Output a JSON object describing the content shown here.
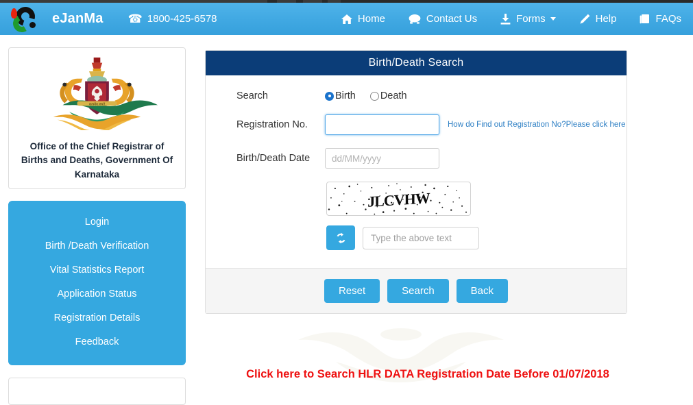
{
  "navbar": {
    "brand": "eJanMa",
    "phone": "1800-425-6578",
    "phone_icon": "phone-icon",
    "links": [
      {
        "label": "Home",
        "icon": "home-icon",
        "has_caret": false
      },
      {
        "label": "Contact Us",
        "icon": "telephone-icon",
        "has_caret": false
      },
      {
        "label": "Forms",
        "icon": "download-icon",
        "has_caret": true
      },
      {
        "label": "Help",
        "icon": "pencil-icon",
        "has_caret": false
      },
      {
        "label": "FAQs",
        "icon": "book-icon",
        "has_caret": false
      }
    ]
  },
  "sidebar": {
    "emblem_icon": "karnataka-state-emblem",
    "emblem_caption": "Office of the Chief Registrar of Births and Deaths, Government Of Karnataka",
    "menu": [
      {
        "label": "Login"
      },
      {
        "label": "Birth /Death Verification"
      },
      {
        "label": "Vital Statistics Report"
      },
      {
        "label": "Application Status"
      },
      {
        "label": "Registration Details"
      },
      {
        "label": "Feedback"
      }
    ]
  },
  "panel": {
    "title": "Birth/Death Search",
    "search_label": "Search",
    "search_options": [
      {
        "label": "Birth",
        "selected": true
      },
      {
        "label": "Death",
        "selected": false
      }
    ],
    "registration_label": "Registration No.",
    "registration_value": "",
    "registration_placeholder": "",
    "registration_help_link": "How do Find out Registration No?Please click here",
    "date_label": "Birth/Death Date",
    "date_value": "",
    "date_placeholder": "dd/MM/yyyy",
    "captcha_text": "JLCVHW",
    "refresh_icon": "refresh-icon",
    "captcha_input_value": "",
    "captcha_input_placeholder": "Type the above text",
    "buttons": [
      {
        "label": "Reset"
      },
      {
        "label": "Search"
      },
      {
        "label": "Back"
      }
    ]
  },
  "footer_note": "Click here to Search HLR DATA Registration Date Before 01/07/2018",
  "colors": {
    "nav_blue": "#40a8e2",
    "panel_header_navy": "#0b3d78",
    "accent_blue": "#35a8e0",
    "link_blue": "#2d7fc4",
    "alert_red": "#ee1111",
    "footer_gray": "#f5f5f5"
  }
}
